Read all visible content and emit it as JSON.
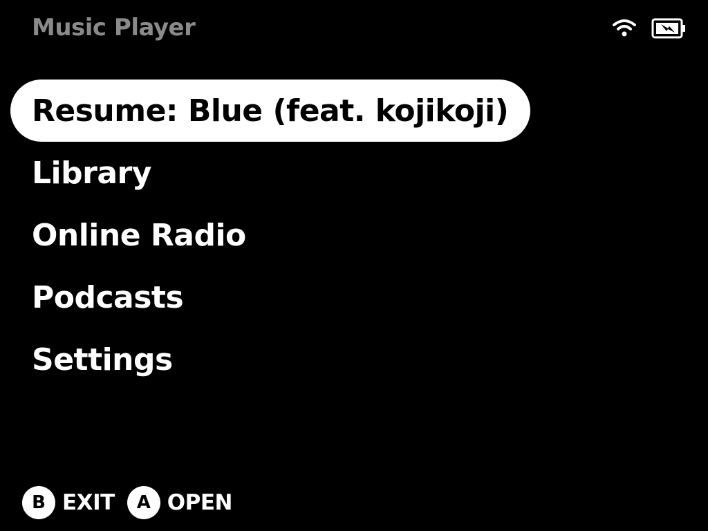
{
  "app": {
    "title": "Music Player"
  },
  "status": {
    "wifi_icon": "wifi-icon",
    "battery_icon": "battery-charging-icon"
  },
  "menu": {
    "items": [
      {
        "label": "Resume: Blue (feat. kojikoji)",
        "selected": true
      },
      {
        "label": "Library",
        "selected": false
      },
      {
        "label": "Online Radio",
        "selected": false
      },
      {
        "label": "Podcasts",
        "selected": false
      },
      {
        "label": "Settings",
        "selected": false
      }
    ]
  },
  "footer": {
    "hints": [
      {
        "key": "B",
        "label": "EXIT"
      },
      {
        "key": "A",
        "label": "OPEN"
      }
    ]
  },
  "colors": {
    "background": "#000000",
    "title": "#8a8a8a",
    "text": "#ffffff",
    "selected_bg": "#ffffff",
    "selected_text": "#000000"
  }
}
